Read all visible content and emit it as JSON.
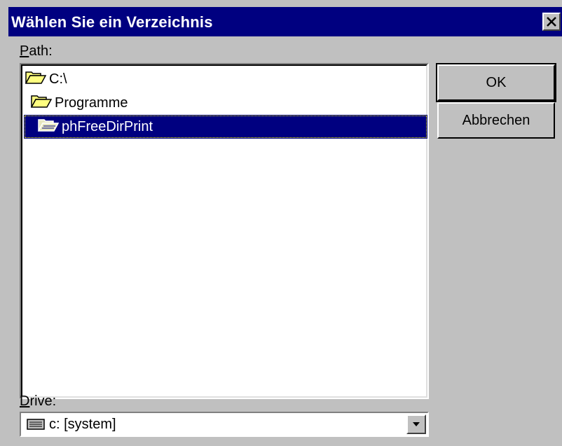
{
  "window": {
    "title": "Wählen Sie ein Verzeichnis"
  },
  "path": {
    "label_prefix": "P",
    "label_rest": "ath:",
    "items": [
      {
        "label": "C:\\",
        "icon": "open-folder-icon"
      },
      {
        "label": "Programme",
        "icon": "open-folder-icon"
      },
      {
        "label": "phFreeDirPrint",
        "icon": "open-folder-icon",
        "selected": true
      }
    ]
  },
  "drive": {
    "label_prefix": "D",
    "label_rest": "rive:",
    "value": "c: [system]",
    "icon": "drive-icon"
  },
  "buttons": {
    "ok": "OK",
    "cancel": "Abbrechen"
  },
  "colors": {
    "titlebar": "#000080",
    "selection": "#000080",
    "face": "#c0c0c0"
  }
}
